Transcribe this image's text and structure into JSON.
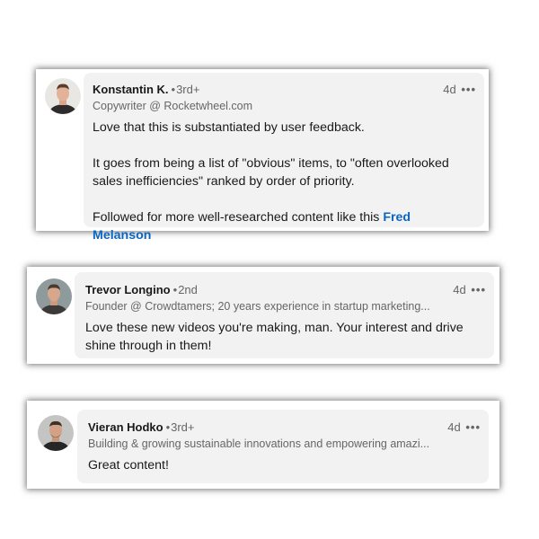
{
  "comments": [
    {
      "name": "Konstantin K.",
      "degree": "3rd+",
      "headline": "Copywriter @ Rocketwheel.com",
      "time": "4d",
      "more_icon": "more-horizontal-icon",
      "paragraphs": [
        "Love that this is substantiated by user feedback.",
        "It goes from being a list of \"obvious\" items, to \"often overlooked sales inefficiencies\" ranked by order of priority.",
        "Followed for more well-researched content like this"
      ],
      "mention": "Fred Melanson"
    },
    {
      "name": "Trevor Longino",
      "degree": "2nd",
      "headline": "Founder @ Crowdtamers; 20 years experience in startup marketing...",
      "time": "4d",
      "more_icon": "more-horizontal-icon",
      "paragraphs": [
        "Love these new videos you're making, man. Your interest and drive shine through in them!"
      ]
    },
    {
      "name": "Vieran Hodko",
      "degree": "3rd+",
      "headline": "Building & growing sustainable innovations and empowering amazi...",
      "time": "4d",
      "more_icon": "more-horizontal-icon",
      "paragraphs": [
        "Great content!"
      ]
    }
  ],
  "separator": "•",
  "more_glyph": "•••",
  "colors": {
    "link": "#0a66c2",
    "bubble": "#f2f2f2",
    "secondary_text": "#666666"
  }
}
